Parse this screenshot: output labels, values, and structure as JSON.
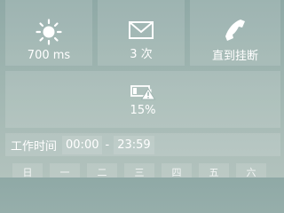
{
  "tiles": {
    "vibration": {
      "icon": "sun-icon",
      "label": "700 ms"
    },
    "count": {
      "icon": "mail-icon",
      "label": "3 次"
    },
    "until": {
      "icon": "phone-icon",
      "label": "直到挂断"
    },
    "battery": {
      "icon": "battery-warning-icon",
      "label": "15%"
    }
  },
  "work_time": {
    "label": "工作时间",
    "start": "00:00",
    "separator": "-",
    "end": "23:59"
  },
  "days": [
    "日",
    "一",
    "二",
    "三",
    "四",
    "五",
    "六"
  ]
}
